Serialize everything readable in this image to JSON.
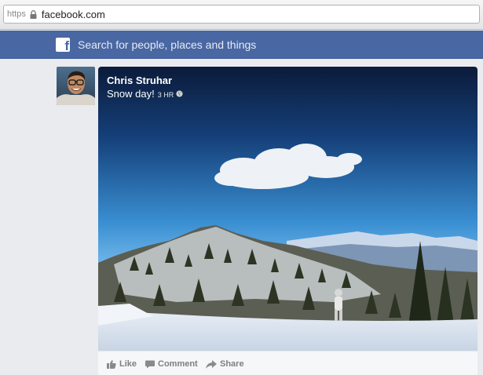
{
  "browser": {
    "scheme": "https",
    "url": "facebook.com"
  },
  "topbar": {
    "search_placeholder": "Search for people, places and things"
  },
  "post": {
    "author": "Chris Struhar",
    "caption": "Snow day!",
    "time": "3 HR",
    "actions": {
      "like": "Like",
      "comment": "Comment",
      "share": "Share"
    }
  },
  "colors": {
    "facebook_blue": "#4967a2",
    "page_bg": "#e9ebee"
  }
}
